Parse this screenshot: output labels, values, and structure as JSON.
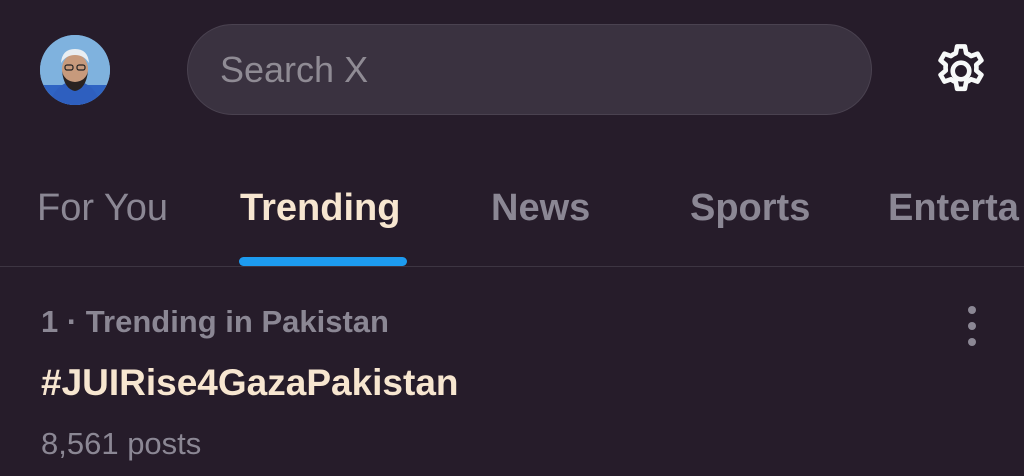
{
  "header": {
    "avatar_icon": "user-avatar",
    "search": {
      "placeholder": "Search X"
    },
    "settings_icon": "gear-icon"
  },
  "tabs": [
    {
      "label": "For You",
      "active": false
    },
    {
      "label": "Trending",
      "active": true
    },
    {
      "label": "News",
      "active": false
    },
    {
      "label": "Sports",
      "active": false
    },
    {
      "label": "Enterta",
      "active": false
    }
  ],
  "trends": [
    {
      "meta": "1 · Trending in Pakistan",
      "title": "#JUIRise4GazaPakistan",
      "count": "8,561 posts"
    }
  ],
  "colors": {
    "background": "#261c2a",
    "accent": "#1d9bf0",
    "active_text": "#f7e6d0",
    "muted_text": "#8b8794"
  }
}
